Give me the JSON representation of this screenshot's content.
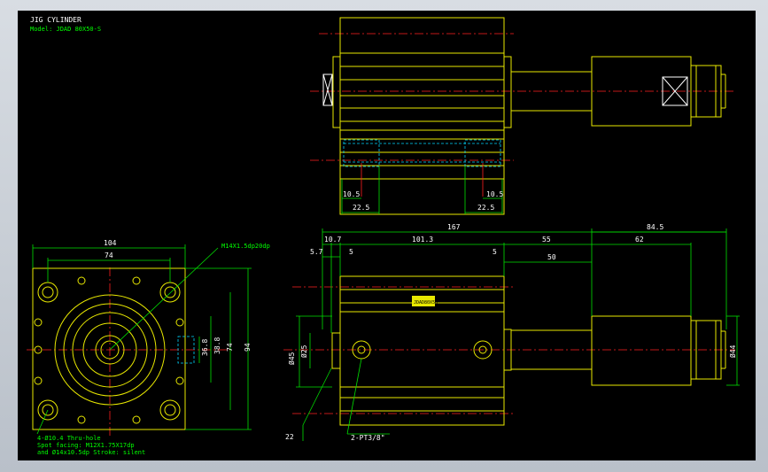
{
  "title_block": {
    "title": "JIG CYLINDER",
    "model": "Model: JDAD 80X50-S"
  },
  "front_view": {
    "width_outer": "104",
    "width_inner": "74",
    "port_thread": "M14X1.5dp20dp",
    "height_inner": "38.8",
    "height_sub": "36.8",
    "height_mid": "74",
    "height_outer": "94",
    "note_1": "4-Ø10.4 Thru-hole",
    "note_2": "Spot facing: M12X1.75X17dp",
    "note_3": "and Ø14x10.5dp Stroke: silent"
  },
  "top_view": {
    "left_offset": "10.5",
    "left_width": "22.5",
    "right_offset": "10.5",
    "right_width": "22.5"
  },
  "side_view": {
    "total_length": "167",
    "rod_length": "84.5",
    "dim_a": "10.7",
    "dim_b": "101.3",
    "dim_c": "55",
    "dim_d": "62",
    "dim_e": "5.7",
    "dim_f": "5",
    "dim_g": "5",
    "dim_h": "50",
    "bore": "Ø45",
    "rod_dia": "Ø25",
    "nut_dia": "Ø44",
    "small_22": "22",
    "port_note": "2-PT3/8\"",
    "label_box": "JDAD80X50"
  },
  "colors": {
    "background": "#000000",
    "outline": "#e8e800",
    "dimension": "#00e000",
    "center": "#ff2020",
    "hidden": "#00d8ff"
  }
}
